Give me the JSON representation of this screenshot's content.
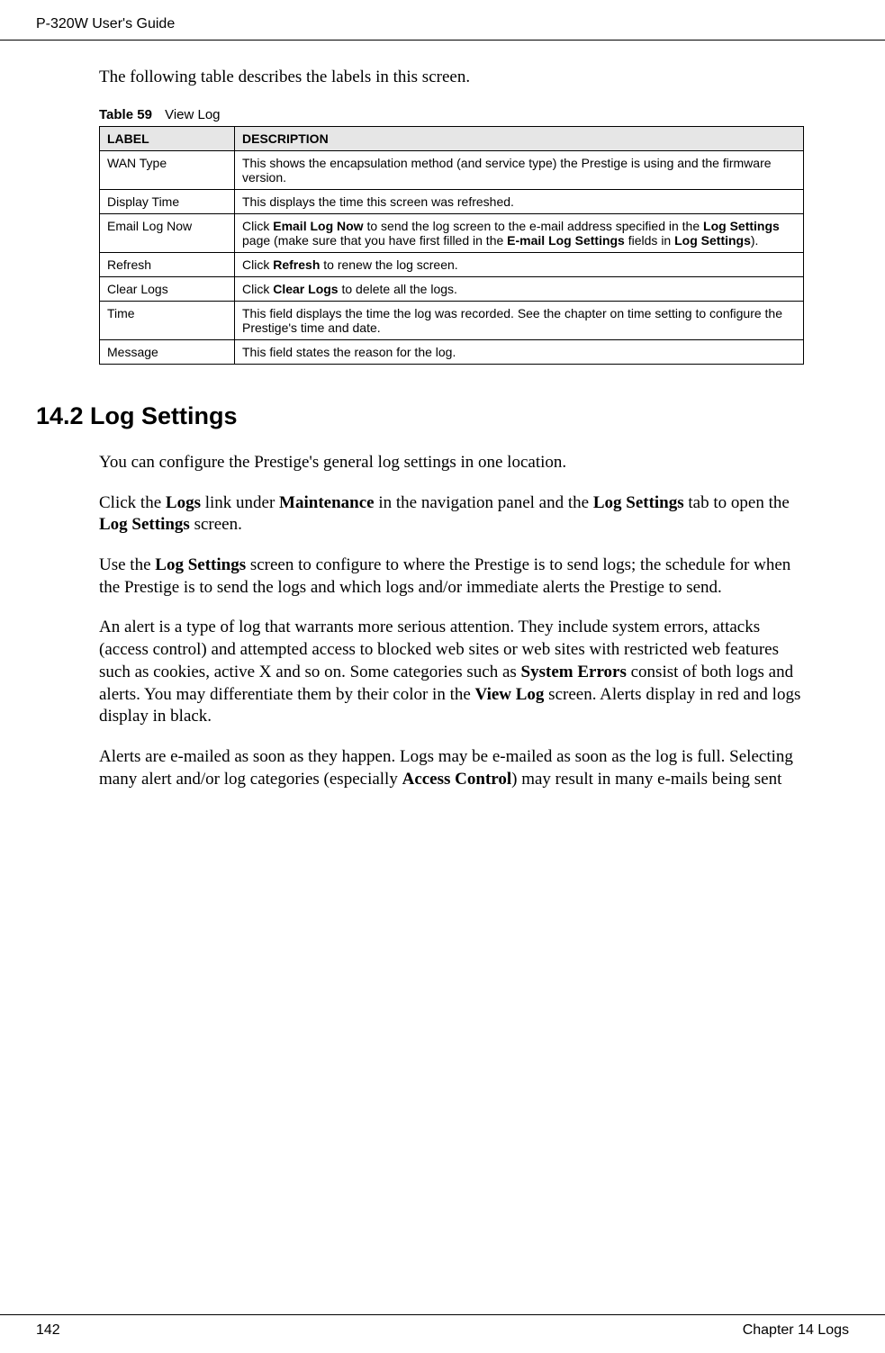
{
  "header": {
    "guide_title": "P-320W User's Guide"
  },
  "intro": "The following table describes the labels in this screen.",
  "table": {
    "caption_number": "Table 59",
    "caption_title": "View Log",
    "headers": {
      "label": "LABEL",
      "description": "DESCRIPTION"
    },
    "rows": [
      {
        "label": "WAN Type",
        "desc_parts": [
          {
            "text": "This shows the encapsulation method (and service type) the Prestige is using and the firmware version.",
            "bold": false
          }
        ]
      },
      {
        "label": "Display Time",
        "desc_parts": [
          {
            "text": "This displays the time this screen was refreshed.",
            "bold": false
          }
        ]
      },
      {
        "label": "Email Log Now",
        "desc_parts": [
          {
            "text": "Click ",
            "bold": false
          },
          {
            "text": "Email Log Now",
            "bold": true
          },
          {
            "text": " to send the log screen to the e-mail address specified in the ",
            "bold": false
          },
          {
            "text": "Log Settings",
            "bold": true
          },
          {
            "text": " page (make sure that you have first filled in the ",
            "bold": false
          },
          {
            "text": "E-mail Log Settings",
            "bold": true
          },
          {
            "text": " fields in ",
            "bold": false
          },
          {
            "text": "Log Settings",
            "bold": true
          },
          {
            "text": ").",
            "bold": false
          }
        ]
      },
      {
        "label": "Refresh",
        "desc_parts": [
          {
            "text": "Click ",
            "bold": false
          },
          {
            "text": "Refresh",
            "bold": true
          },
          {
            "text": " to renew the log screen.",
            "bold": false
          }
        ]
      },
      {
        "label": "Clear Logs",
        "desc_parts": [
          {
            "text": "Click ",
            "bold": false
          },
          {
            "text": "Clear Logs",
            "bold": true
          },
          {
            "text": " to delete all the logs.",
            "bold": false
          }
        ]
      },
      {
        "label": "Time",
        "desc_parts": [
          {
            "text": "This field displays the time the log was recorded. See the chapter on time setting to configure the Prestige's time and date.",
            "bold": false
          }
        ]
      },
      {
        "label": "Message",
        "desc_parts": [
          {
            "text": "This field states the reason for the log.",
            "bold": false
          }
        ]
      }
    ]
  },
  "section": {
    "heading": "14.2  Log Settings",
    "paragraphs": [
      [
        {
          "text": "You can configure the Prestige's general log settings in one location.",
          "bold": false
        }
      ],
      [
        {
          "text": "Click the ",
          "bold": false
        },
        {
          "text": "Logs",
          "bold": true
        },
        {
          "text": " link under ",
          "bold": false
        },
        {
          "text": "Maintenance",
          "bold": true
        },
        {
          "text": " in the navigation panel and the ",
          "bold": false
        },
        {
          "text": "Log Settings",
          "bold": true
        },
        {
          "text": " tab to open the ",
          "bold": false
        },
        {
          "text": "Log Settings",
          "bold": true
        },
        {
          "text": " screen.",
          "bold": false
        }
      ],
      [
        {
          "text": "Use the ",
          "bold": false
        },
        {
          "text": "Log Settings",
          "bold": true
        },
        {
          "text": " screen to configure to where the Prestige is to send logs; the schedule for when the Prestige is to send the logs and which logs and/or immediate alerts the Prestige to send.",
          "bold": false
        }
      ],
      [
        {
          "text": "An alert is a type of log that warrants more serious attention. They include system errors, attacks (access control) and attempted access to blocked web sites or web sites with restricted web features such as cookies, active X and so on. Some categories such as ",
          "bold": false
        },
        {
          "text": "System Errors",
          "bold": true
        },
        {
          "text": " consist of both logs and alerts. You may differentiate them by their color in the ",
          "bold": false
        },
        {
          "text": "View Log",
          "bold": true
        },
        {
          "text": " screen. Alerts display in red and logs display in black.",
          "bold": false
        }
      ],
      [
        {
          "text": "Alerts are e-mailed as soon as they happen. Logs may be e-mailed as soon as the log is full. Selecting many alert and/or log categories (especially ",
          "bold": false
        },
        {
          "text": "Access Control",
          "bold": true
        },
        {
          "text": ") may result in many e-mails being sent",
          "bold": false
        }
      ]
    ]
  },
  "footer": {
    "page_number": "142",
    "chapter": "Chapter 14 Logs"
  }
}
